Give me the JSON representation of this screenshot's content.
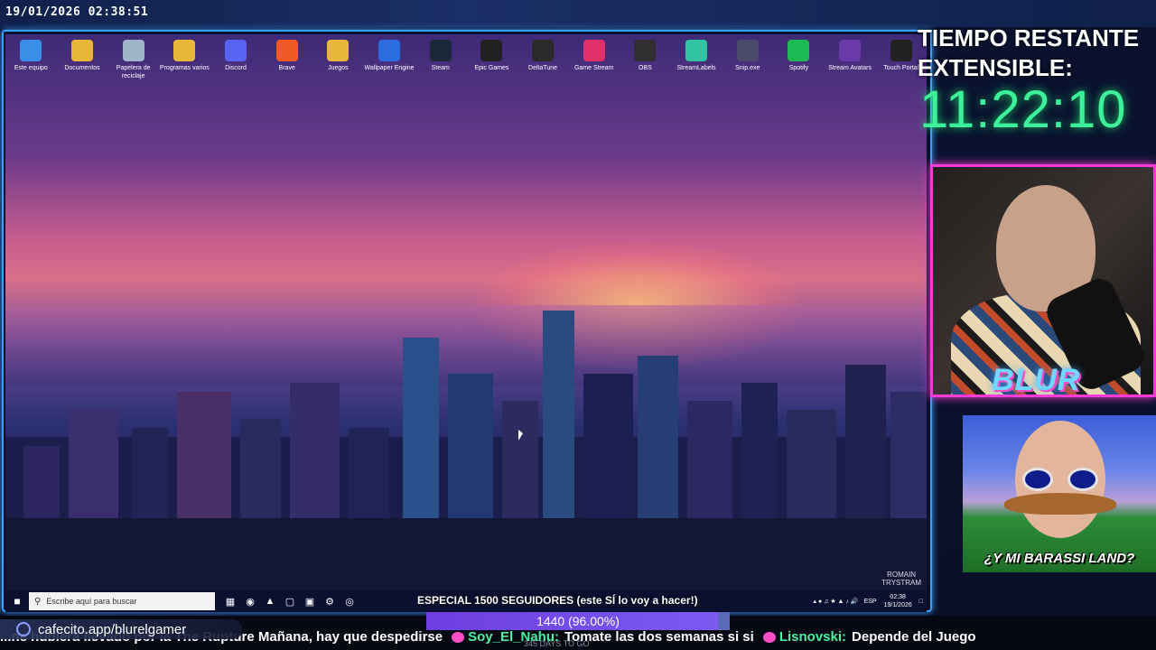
{
  "overlay": {
    "timestamp": "19/01/2026 02:38:51",
    "timer_title": "TIEMPO RESTANTE EXTENSIBLE:",
    "timer_value": "11:22:10",
    "logo": "BLUR",
    "promo_caption": "¿Y MI BARASSI LAND?",
    "donation_link": "cafecito.app/blurelgamer",
    "goal_banner": "ESPECIAL 1500 SEGUIDORES (este SÍ lo voy a hacer!)",
    "progress_label": "1440 (96.00%)",
    "progress_fraction": 0.96,
    "days_left": "345 DAYS TO GO"
  },
  "desktop": {
    "icons": [
      {
        "label": "Este equipo",
        "icon": "computer-icon",
        "color": "#3b8ee8"
      },
      {
        "label": "Documentos",
        "icon": "folder-icon",
        "color": "#e8b63b"
      },
      {
        "label": "Papelera de reciclaje",
        "icon": "recycle-bin-icon",
        "color": "#9fb4c8"
      },
      {
        "label": "Programas varios",
        "icon": "folder-icon",
        "color": "#e8b63b"
      },
      {
        "label": "Discord",
        "icon": "discord-icon",
        "color": "#5865f2"
      },
      {
        "label": "Brave",
        "icon": "brave-icon",
        "color": "#f15a22"
      },
      {
        "label": "Juegos",
        "icon": "folder-icon",
        "color": "#e8b63b"
      },
      {
        "label": "Wallpaper Engine",
        "icon": "wallpaper-engine-icon",
        "color": "#2a6de0"
      },
      {
        "label": "Steam",
        "icon": "steam-icon",
        "color": "#1b2838"
      },
      {
        "label": "Epic Games",
        "icon": "epic-games-icon",
        "color": "#222"
      },
      {
        "label": "DeltaTune",
        "icon": "music-note-icon",
        "color": "#2a2a2a"
      },
      {
        "label": "Game Stream",
        "icon": "map-pin-icon",
        "color": "#e0306a"
      },
      {
        "label": "OBS",
        "icon": "obs-icon",
        "color": "#302e31"
      },
      {
        "label": "StreamLabels",
        "icon": "streamlabels-icon",
        "color": "#31c3a2"
      },
      {
        "label": "Snip.exe",
        "icon": "snip-icon",
        "color": "#4a4a6a"
      },
      {
        "label": "Spotify",
        "icon": "spotify-icon",
        "color": "#1db954"
      },
      {
        "label": "Stream Avatars",
        "icon": "stream-avatars-icon",
        "color": "#6a3aa8"
      },
      {
        "label": "Touch Portal",
        "icon": "touch-portal-icon",
        "color": "#222"
      }
    ],
    "watermark_line1": "ROMAIN",
    "watermark_line2": "TRYSTRAM"
  },
  "taskbar": {
    "search_placeholder": "Escribe aquí para buscar",
    "language": "ESP",
    "time": "02:38",
    "date": "19/1/2026"
  },
  "ticker": [
    {
      "type": "text",
      "text": "...ne hubiera llevado por la The Rupture Mañana, hay que despedirse"
    },
    {
      "type": "user",
      "text": "Soy_El_Nahu:"
    },
    {
      "type": "text",
      "text": "Tomate las dos semanas si si"
    },
    {
      "type": "user",
      "text": "Lisnovski:"
    },
    {
      "type": "text",
      "text": "Depende del Juego"
    }
  ],
  "colors": {
    "timer_green": "#3df09a",
    "webcam_border": "#ff3ad8",
    "screen_border": "#3aa0ff",
    "progress_fill": "#6e3ee0"
  }
}
